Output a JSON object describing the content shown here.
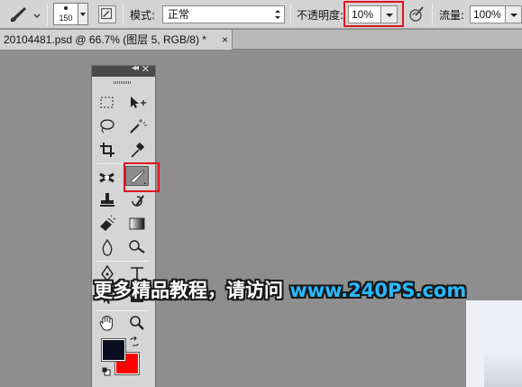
{
  "options_bar": {
    "brush_size": "150",
    "mode_label": "模式:",
    "mode_value": "正常",
    "opacity_label": "不透明度:",
    "opacity_value": "10%",
    "flow_label": "流量:",
    "flow_value": "100%",
    "highlight_color": "#e0141e"
  },
  "document_tab": {
    "title": "20104481.psd @ 66.7% (图层 5, RGB/8) *",
    "close": "×"
  },
  "tools_panel": {
    "collapse_glyph": "◂◂",
    "close_glyph": "✕",
    "active_tool": "brush-tool",
    "tools": [
      "rectangular-marquee",
      "move",
      "lasso",
      "magic-wand",
      "crop",
      "eyedropper",
      "spot-healing",
      "brush",
      "clone-stamp",
      "history-brush",
      "eraser",
      "gradient",
      "blur",
      "dodge",
      "pen",
      "type",
      "path-selection",
      "shape",
      "hand",
      "zoom"
    ]
  },
  "colors": {
    "foreground": "#0b0d20",
    "background": "#ff0000"
  },
  "watermark": {
    "text_cn": "更多精品教程，请访问",
    "url": "www.240PS.com"
  }
}
